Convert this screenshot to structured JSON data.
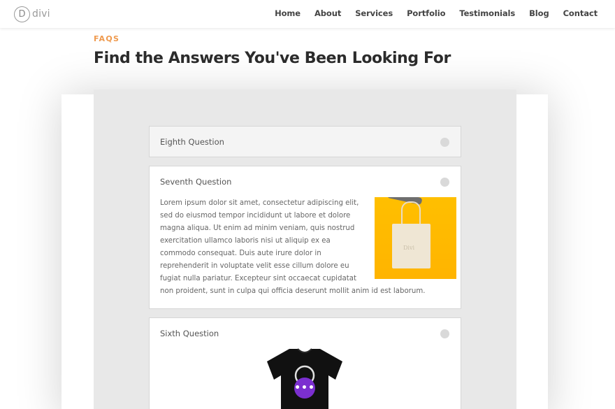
{
  "header": {
    "logo_mark": "D",
    "logo_text": "divi",
    "nav": [
      "Home",
      "About",
      "Services",
      "Portfolio",
      "Testimonials",
      "Blog",
      "Contact"
    ]
  },
  "intro": {
    "eyebrow": "FAQS",
    "headline": "Find the Answers You've Been Looking For"
  },
  "faq": {
    "items": [
      {
        "title": "Eighth Question",
        "state": "closed"
      },
      {
        "title": "Seventh Question",
        "state": "open",
        "body": "Lorem ipsum dolor sit amet, consectetur adipiscing elit, sed do eiusmod tempor incididunt ut labore et dolore magna aliqua. Ut enim ad minim veniam, quis nostrud exercitation ullamco laboris nisi ut aliquip ex ea commodo consequat. Duis aute irure dolor in reprehenderit in voluptate velit esse cillum dolore eu fugiat nulla pariatur. Excepteur sint occaecat cupidatat non proident, sunt in culpa qui officia deserunt mollit anim id est laborum.",
        "image_text": "Divi"
      },
      {
        "title": "Sixth Question",
        "state": "open"
      }
    ],
    "fab_label": "•••"
  },
  "colors": {
    "accent_eyebrow": "#ef9a4e",
    "fab_purple": "#7b2fd0",
    "section_gray": "#e8e8e8",
    "bag_yellow": "#ffbf00"
  },
  "icons": [
    "toggle-closed-icon",
    "toggle-open-icon",
    "more-options-icon"
  ]
}
